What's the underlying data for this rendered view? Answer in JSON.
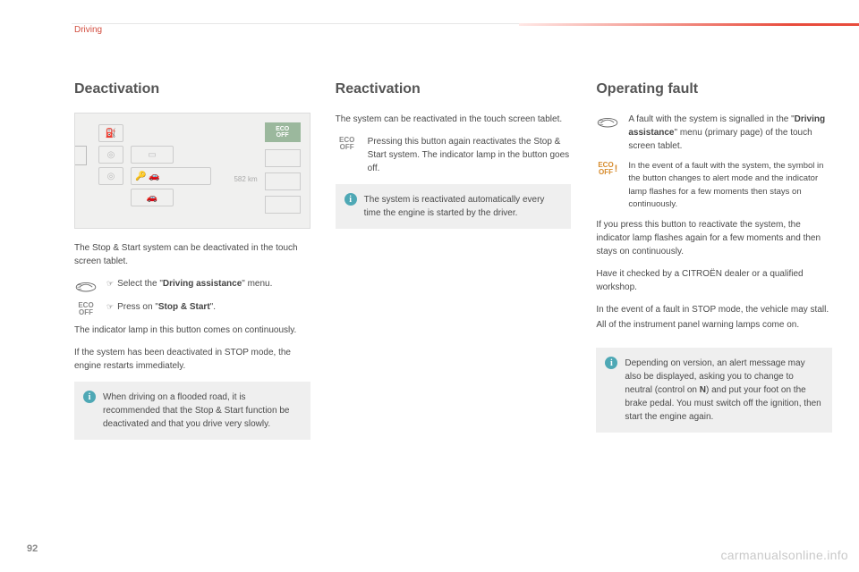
{
  "section": "Driving",
  "page_number": "92",
  "watermark": "carmanualsonline.info",
  "screenshot": {
    "eco_label": "ECO\nOFF",
    "km": "582 km"
  },
  "col1": {
    "heading": "Deactivation",
    "p1": "The Stop & Start system can be deactivated in the touch screen tablet.",
    "step1_text_a": "Select the \"",
    "step1_bold": "Driving assistance",
    "step1_text_b": "\" menu.",
    "step2_text_a": "Press on \"",
    "step2_bold": "Stop & Start",
    "step2_text_b": "\".",
    "p2": "The indicator lamp in this button comes on continuously.",
    "p3": "If the system has been deactivated in STOP mode, the engine restarts immediately.",
    "note": "When driving on a flooded road, it is recommended that the Stop & Start function be deactivated and that you drive very slowly."
  },
  "col2": {
    "heading": "Reactivation",
    "p1": "The system can be reactivated in the touch screen tablet.",
    "step1": "Pressing this button again reactivates the Stop & Start system. The indicator lamp in the button goes off.",
    "note": "The system is reactivated automatically every time the engine is started by the driver."
  },
  "col3": {
    "heading": "Operating fault",
    "row1_a": "A fault with the system is signalled in the \"",
    "row1_bold": "Driving assistance",
    "row1_b": "\" menu (primary page) of the touch screen tablet.",
    "row2": "In the event of a fault with the system, the symbol in the button changes to alert mode and the indicator lamp flashes for a few moments then stays on continuously.",
    "p1": "If you press this button to reactivate the system, the indicator lamp flashes again for a few moments and then stays on continuously.",
    "p2": "Have it checked by a CITROËN dealer or a qualified workshop.",
    "p3": "In the event of a fault in STOP mode, the vehicle may stall.",
    "p4": "All of the instrument panel warning lamps come on.",
    "note_a": "Depending on version, an alert message may also be displayed, asking you to change to neutral (control on ",
    "note_bold": "N",
    "note_b": ") and put your foot on the brake pedal. You must switch off the ignition, then start the engine again."
  },
  "icons": {
    "eco_off": "ECO\nOFF"
  }
}
